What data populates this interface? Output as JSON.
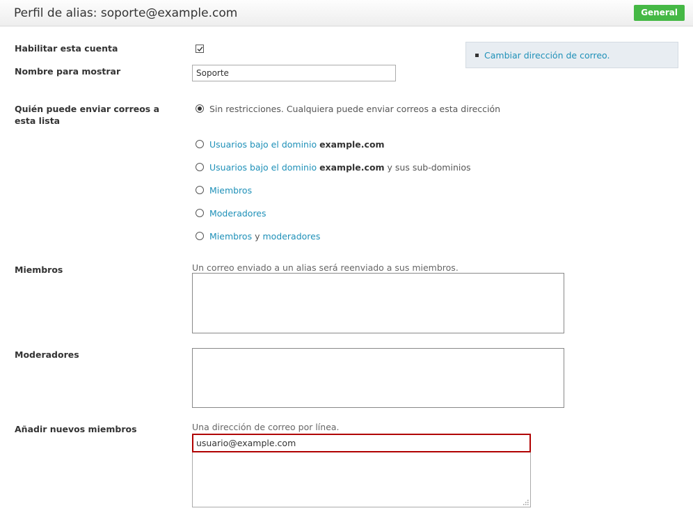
{
  "header": {
    "title": "Perfil de alias: soporte@example.com",
    "tab_label": "General"
  },
  "form": {
    "enable_label": "Habilitar esta cuenta",
    "enable_checked": true,
    "display_name_label": "Nombre para mostrar",
    "display_name_value": "Soporte",
    "who_can_send_label": "Quién puede enviar correos a esta lista",
    "options": [
      {
        "text": "Sin restricciones. Cualquiera puede enviar correos a esta dirección",
        "checked": true
      },
      {
        "link": "Usuarios bajo el dominio",
        "domain": "example.com"
      },
      {
        "link": "Usuarios bajo el dominio",
        "domain": "example.com",
        "suffix": "y sus sub-dominios"
      },
      {
        "link": "Miembros"
      },
      {
        "link": "Moderadores"
      },
      {
        "link_a": "Miembros",
        "joiner": "y",
        "link_b": "moderadores"
      }
    ],
    "members_label": "Miembros",
    "members_hint": "Un correo enviado a un alias será reenviado a sus miembros.",
    "moderators_label": "Moderadores",
    "add_members_label": "Añadir nuevos miembros",
    "add_members_hint": "Una dirección de correo por línea.",
    "add_members_value": "usuario@example.com"
  },
  "side_panel": {
    "link": "Cambiar dirección de correo."
  },
  "colors": {
    "link": "#1e90b8",
    "tab_green": "#45b845",
    "panel_bg": "#e8edf2",
    "error_border": "#b00000"
  }
}
